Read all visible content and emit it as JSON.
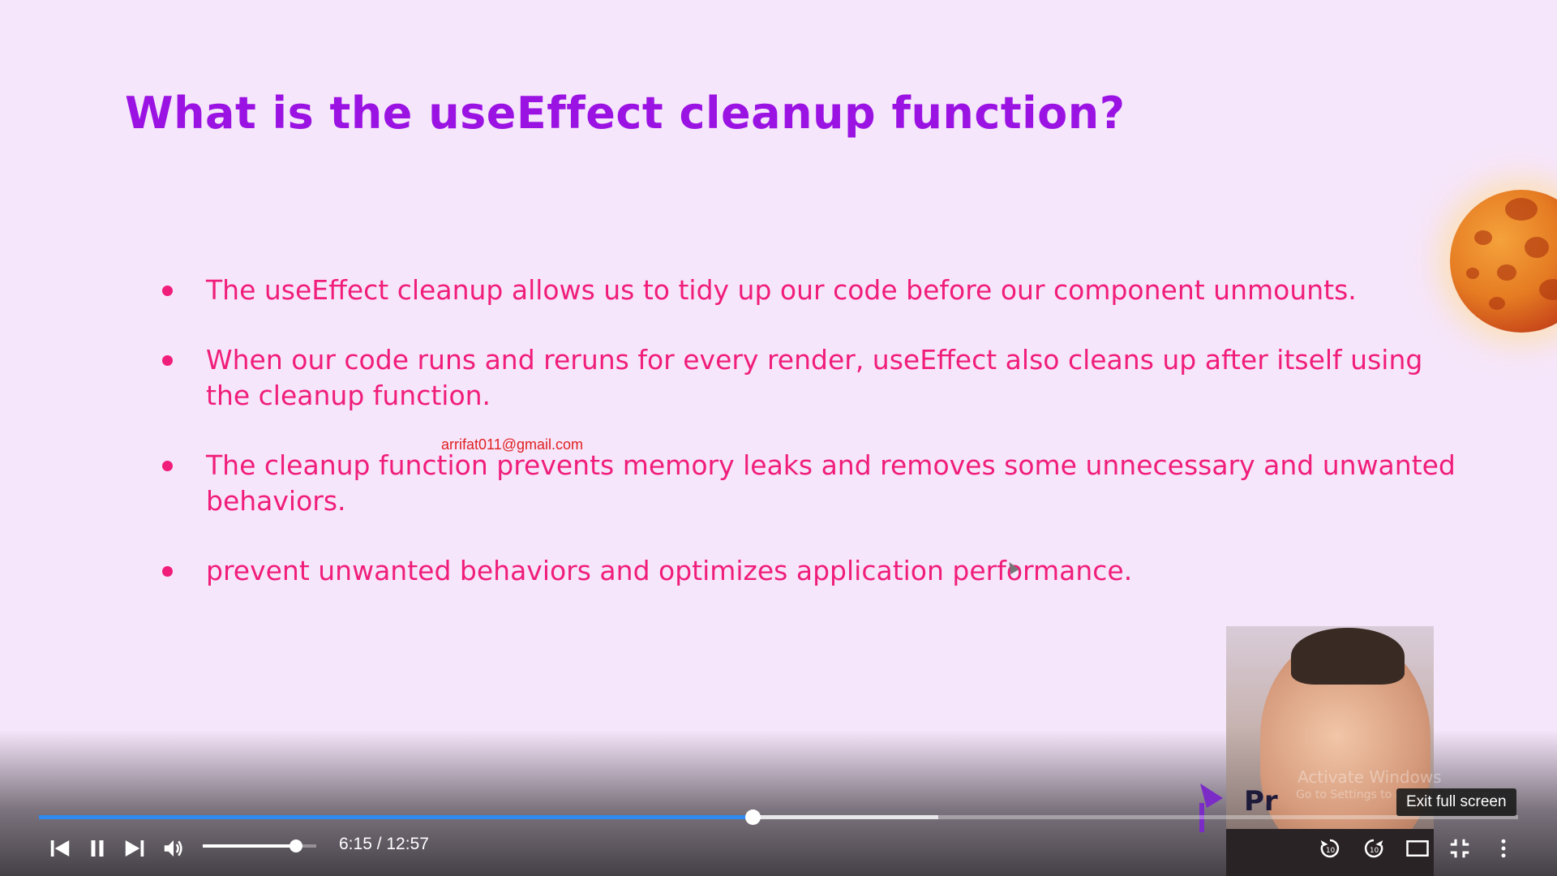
{
  "slide": {
    "title": "What is the useEffect cleanup function?",
    "bullets": [
      "The useEffect cleanup allows us to tidy up our code before our component unmounts.",
      "When our code runs and reruns for every render, useEffect also cleans up after itself using the cleanup function.",
      "The cleanup function prevents memory leaks and removes some unnecessary and unwanted behaviors.",
      "prevent unwanted behaviors and optimizes application performance."
    ],
    "watermark_email": "arrifat011@gmail.com",
    "title_color": "#9a13e3",
    "bullet_color": "#f01d7a"
  },
  "overlay": {
    "brand_text": "Pr",
    "activate_windows": "Activate Windows",
    "activate_windows_sub": "Go to Settings to activate Windows."
  },
  "player": {
    "time_display": "6:15 / 12:57",
    "progress_fraction": 0.4826,
    "buffered_fraction": 0.608,
    "volume_fraction": 0.82,
    "tooltip": "Exit full screen",
    "accent_color": "#2f8bf0",
    "icons": [
      "previous-icon",
      "pause-icon",
      "next-icon",
      "volume-icon",
      "rewind-10-icon",
      "forward-10-icon",
      "theater-mode-icon",
      "exit-fullscreen-icon",
      "more-options-icon"
    ]
  }
}
